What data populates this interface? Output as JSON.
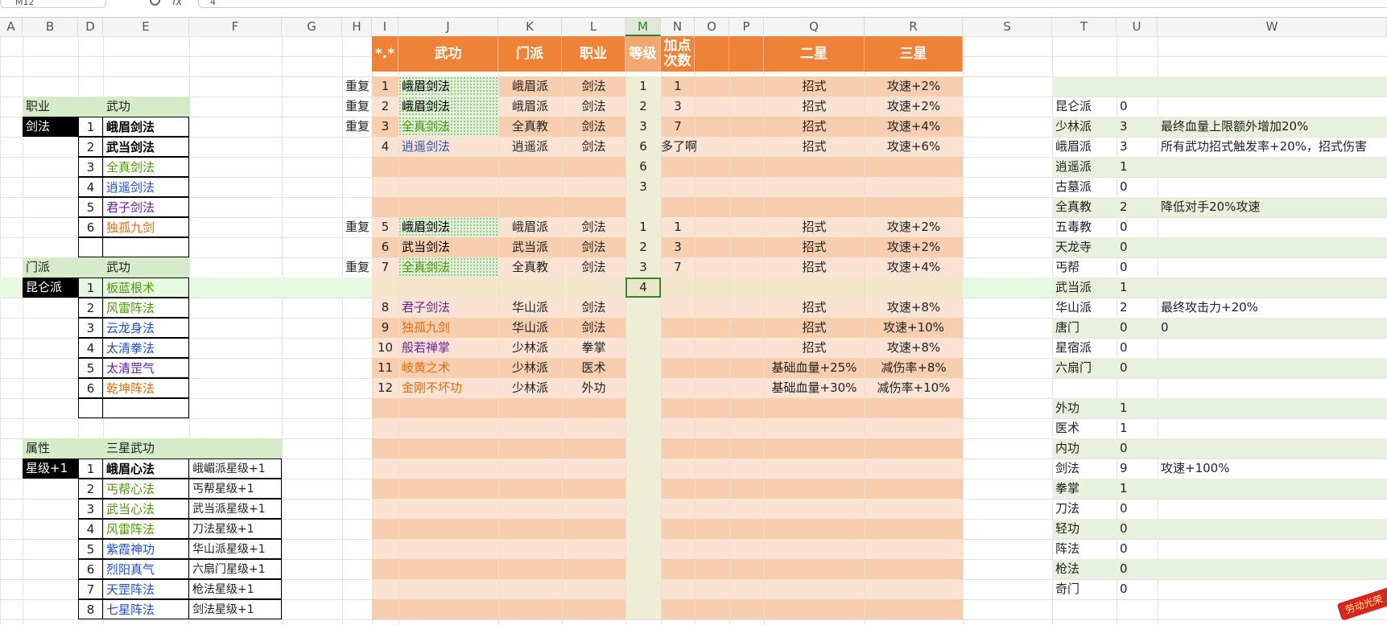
{
  "topbar": {
    "name_box": "M12",
    "fx": "fx",
    "formula": "4"
  },
  "colors": {
    "orange_header": "#ee8236",
    "peach_dark": "#f8cfae",
    "peach_light": "#fbe3d3",
    "green_label": "#d6ecc8",
    "green_stripe": "#e7f1dd",
    "green_row": "#e6f9e1",
    "selected_col": "#eeeed8",
    "black_label": "#000000"
  },
  "columns": [
    "A",
    "B",
    "D",
    "E",
    "F",
    "G",
    "H",
    "I",
    "J",
    "K",
    "L",
    "M",
    "N",
    "O",
    "P",
    "Q",
    "R",
    "S",
    "T",
    "U",
    "W"
  ],
  "panel1": {
    "header_a": "职业",
    "header_b": "武功",
    "category": "剑法",
    "items": [
      {
        "n": "1",
        "name": "峨眉剑法",
        "color": "#000000",
        "bold": true
      },
      {
        "n": "2",
        "name": "武当剑法",
        "color": "#000000",
        "bold": true
      },
      {
        "n": "3",
        "name": "全真剑法",
        "color": "#4e9a06",
        "bold": false
      },
      {
        "n": "4",
        "name": "逍遥剑法",
        "color": "#1f4fcc",
        "bold": false
      },
      {
        "n": "5",
        "name": "君子剑法",
        "color": "#6a1fa5",
        "bold": false
      },
      {
        "n": "6",
        "name": "独孤九剑",
        "color": "#e36b0e",
        "bold": false
      }
    ]
  },
  "panel2": {
    "header_a": "门派",
    "header_b": "武功",
    "category": "昆仑派",
    "items": [
      {
        "n": "1",
        "name": "板蓝根术",
        "color": "#4e9a06",
        "bold": false
      },
      {
        "n": "2",
        "name": "风雷阵法",
        "color": "#4e9a06",
        "bold": false
      },
      {
        "n": "3",
        "name": "云龙身法",
        "color": "#1f4fcc",
        "bold": false
      },
      {
        "n": "4",
        "name": "太清拳法",
        "color": "#1f4fcc",
        "bold": false
      },
      {
        "n": "5",
        "name": "太清罡气",
        "color": "#6a1fa5",
        "bold": false
      },
      {
        "n": "6",
        "name": "乾坤阵法",
        "color": "#e36b0e",
        "bold": false
      }
    ]
  },
  "panel3": {
    "header_a": "属性",
    "header_b": "三星武功",
    "category": "星级+1",
    "items": [
      {
        "n": "1",
        "name": "峨眉心法",
        "color": "#000000",
        "bold": true,
        "effect": "峨嵋派星级+1"
      },
      {
        "n": "2",
        "name": "丐帮心法",
        "color": "#4e9a06",
        "bold": false,
        "effect": "丐帮星级+1"
      },
      {
        "n": "3",
        "name": "武当心法",
        "color": "#4e9a06",
        "bold": false,
        "effect": "武当派星级+1"
      },
      {
        "n": "4",
        "name": "风雷阵法",
        "color": "#4e9a06",
        "bold": false,
        "effect": "刀法星级+1"
      },
      {
        "n": "5",
        "name": "紫霞神功",
        "color": "#1f4fcc",
        "bold": false,
        "effect": "华山派星级+1"
      },
      {
        "n": "6",
        "name": "烈阳真气",
        "color": "#1f4fcc",
        "bold": false,
        "effect": "六扇门星级+1"
      },
      {
        "n": "7",
        "name": "天罡阵法",
        "color": "#1f4fcc",
        "bold": false,
        "effect": "枪法星级+1"
      },
      {
        "n": "8",
        "name": "七星阵法",
        "color": "#1f4fcc",
        "bold": false,
        "effect": "剑法星级+1"
      }
    ]
  },
  "main_table": {
    "headers": {
      "idx": "*.*",
      "skill": "武功",
      "sect": "门派",
      "class": "职业",
      "level": "等级",
      "points": "加点次数",
      "o": "",
      "p": "",
      "two_star": "二星",
      "three_star": "三星"
    },
    "rows": [
      {
        "dup": "重复",
        "idx": "1",
        "skill": "峨眉剑法",
        "skill_color": "#000000",
        "hatch": true,
        "sect": "峨眉派",
        "cls": "剑法",
        "level": "1",
        "points": "1",
        "s2": "招式",
        "s3": "攻速+2%"
      },
      {
        "dup": "重复",
        "idx": "2",
        "skill": "峨眉剑法",
        "skill_color": "#000000",
        "hatch": true,
        "sect": "峨眉派",
        "cls": "剑法",
        "level": "2",
        "points": "3",
        "s2": "招式",
        "s3": "攻速+2%"
      },
      {
        "dup": "重复",
        "idx": "3",
        "skill": "全真剑法",
        "skill_color": "#4e9a06",
        "hatch": true,
        "sect": "全真教",
        "cls": "剑法",
        "level": "3",
        "points": "7",
        "s2": "招式",
        "s3": "攻速+4%"
      },
      {
        "dup": "",
        "idx": "4",
        "skill": "逍遥剑法",
        "skill_color": "#1f4fcc",
        "hatch": false,
        "sect": "逍遥派",
        "cls": "剑法",
        "level": "6",
        "points": "多了啊",
        "s2": "招式",
        "s3": "攻速+6%"
      },
      {
        "dup": "",
        "idx": "",
        "skill": "",
        "skill_color": "#000000",
        "hatch": false,
        "sect": "",
        "cls": "",
        "level": "6",
        "points": "",
        "s2": "",
        "s3": ""
      },
      {
        "dup": "",
        "idx": "",
        "skill": "",
        "skill_color": "#000000",
        "hatch": false,
        "sect": "",
        "cls": "",
        "level": "3",
        "points": "",
        "s2": "",
        "s3": ""
      },
      {
        "dup": "",
        "idx": "",
        "skill": "",
        "skill_color": "#000000",
        "hatch": false,
        "sect": "",
        "cls": "",
        "level": "",
        "points": "",
        "s2": "",
        "s3": ""
      },
      {
        "dup": "重复",
        "idx": "5",
        "skill": "峨眉剑法",
        "skill_color": "#000000",
        "hatch": true,
        "sect": "峨眉派",
        "cls": "剑法",
        "level": "1",
        "points": "1",
        "s2": "招式",
        "s3": "攻速+2%"
      },
      {
        "dup": "",
        "idx": "6",
        "skill": "武当剑法",
        "skill_color": "#000000",
        "hatch": false,
        "sect": "武当派",
        "cls": "剑法",
        "level": "2",
        "points": "3",
        "s2": "招式",
        "s3": "攻速+2%"
      },
      {
        "dup": "重复",
        "idx": "7",
        "skill": "全真剑法",
        "skill_color": "#4e9a06",
        "hatch": true,
        "sect": "全真教",
        "cls": "剑法",
        "level": "3",
        "points": "7",
        "s2": "招式",
        "s3": "攻速+4%"
      },
      {
        "dup": "",
        "idx": "",
        "skill": "",
        "skill_color": "#000000",
        "hatch": false,
        "sect": "",
        "cls": "",
        "level": "4",
        "points": "",
        "s2": "",
        "s3": ""
      },
      {
        "dup": "",
        "idx": "8",
        "skill": "君子剑法",
        "skill_color": "#6a1fa5",
        "hatch": false,
        "sect": "华山派",
        "cls": "剑法",
        "level": "",
        "points": "",
        "s2": "招式",
        "s3": "攻速+8%"
      },
      {
        "dup": "",
        "idx": "9",
        "skill": "独孤九剑",
        "skill_color": "#e36b0e",
        "hatch": false,
        "sect": "华山派",
        "cls": "剑法",
        "level": "",
        "points": "",
        "s2": "招式",
        "s3": "攻速+10%"
      },
      {
        "dup": "",
        "idx": "10",
        "skill": "般若禅掌",
        "skill_color": "#6a1fa5",
        "hatch": false,
        "sect": "少林派",
        "cls": "拳掌",
        "level": "",
        "points": "",
        "s2": "招式",
        "s3": "攻速+8%"
      },
      {
        "dup": "",
        "idx": "11",
        "skill": "岐黄之术",
        "skill_color": "#e36b0e",
        "hatch": false,
        "sect": "少林派",
        "cls": "医术",
        "level": "",
        "points": "",
        "s2": "基础血量+25%",
        "s3": "减伤率+8%"
      },
      {
        "dup": "",
        "idx": "12",
        "skill": "金刚不坏功",
        "skill_color": "#e36b0e",
        "hatch": false,
        "sect": "少林派",
        "cls": "外功",
        "level": "",
        "points": "",
        "s2": "基础血量+30%",
        "s3": "减伤率+10%"
      }
    ]
  },
  "summary": {
    "rows": [
      {
        "label": "",
        "count": "",
        "note": ""
      },
      {
        "label": "昆仑派",
        "count": "0",
        "note": ""
      },
      {
        "label": "少林派",
        "count": "3",
        "note": "最终血量上限额外增加20%"
      },
      {
        "label": "峨眉派",
        "count": "3",
        "note": "所有武功招式触发率+20%，招式伤害"
      },
      {
        "label": "逍遥派",
        "count": "1",
        "note": ""
      },
      {
        "label": "古墓派",
        "count": "0",
        "note": ""
      },
      {
        "label": "全真教",
        "count": "2",
        "note": "降低对手20%攻速"
      },
      {
        "label": "五毒教",
        "count": "0",
        "note": ""
      },
      {
        "label": "天龙寺",
        "count": "0",
        "note": ""
      },
      {
        "label": "丐帮",
        "count": "0",
        "note": ""
      },
      {
        "label": "武当派",
        "count": "1",
        "note": ""
      },
      {
        "label": "华山派",
        "count": "2",
        "note": "最终攻击力+20%"
      },
      {
        "label": "唐门",
        "count": "0",
        "note": "0"
      },
      {
        "label": "星宿派",
        "count": "0",
        "note": ""
      },
      {
        "label": "六扇门",
        "count": "0",
        "note": ""
      },
      {
        "label": "",
        "count": "",
        "note": ""
      },
      {
        "label": "外功",
        "count": "1",
        "note": ""
      },
      {
        "label": "医术",
        "count": "1",
        "note": ""
      },
      {
        "label": "内功",
        "count": "0",
        "note": ""
      },
      {
        "label": "剑法",
        "count": "9",
        "note": "攻速+100%"
      },
      {
        "label": "拳掌",
        "count": "1",
        "note": ""
      },
      {
        "label": "刀法",
        "count": "0",
        "note": ""
      },
      {
        "label": "轻功",
        "count": "0",
        "note": ""
      },
      {
        "label": "阵法",
        "count": "0",
        "note": ""
      },
      {
        "label": "枪法",
        "count": "0",
        "note": ""
      },
      {
        "label": "奇门",
        "count": "0",
        "note": ""
      }
    ]
  },
  "ribbon": {
    "text": "劳动光荣"
  }
}
